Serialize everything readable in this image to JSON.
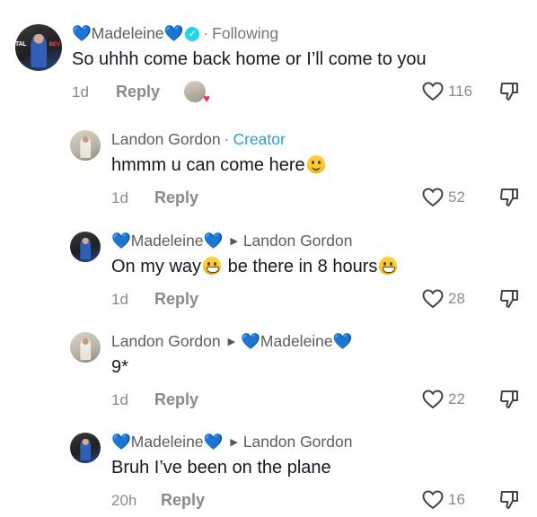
{
  "comments": [
    {
      "username": "💙Madeleine💙",
      "verified": true,
      "following_label": "Following",
      "text": "So uhhh come back home or I’ll come to you",
      "time": "1d",
      "reply_label": "Reply",
      "likes": "116"
    },
    {
      "username": "Landon Gordon",
      "creator_label": "Creator",
      "text": "hmmm u can come here",
      "time": "1d",
      "reply_label": "Reply",
      "likes": "52"
    },
    {
      "username": "💙Madeleine💙",
      "reply_to": "Landon Gordon",
      "text_part1": "On my way",
      "text_part2": " be there in 8 hours",
      "time": "1d",
      "reply_label": "Reply",
      "likes": "28"
    },
    {
      "username": "Landon Gordon",
      "reply_to": "💙Madeleine💙",
      "text": "9*",
      "time": "1d",
      "reply_label": "Reply",
      "likes": "22"
    },
    {
      "username": "💙Madeleine💙",
      "reply_to": "Landon Gordon",
      "text": "Bruh I’ve been on the plane",
      "time": "20h",
      "reply_label": "Reply",
      "likes": "16"
    }
  ],
  "icons": {
    "like": "heart-outline-icon",
    "dislike": "thumbs-down-icon",
    "verified": "verified-badge-icon",
    "reply_arrow": "triangle-right-icon",
    "creator_liked": "creator-liked-avatar-icon"
  },
  "colors": {
    "creator": "#2b9fd8",
    "verified": "#20d5ec",
    "blue_heart": "#8fc5f2",
    "liked_heart": "#ff2b55"
  }
}
